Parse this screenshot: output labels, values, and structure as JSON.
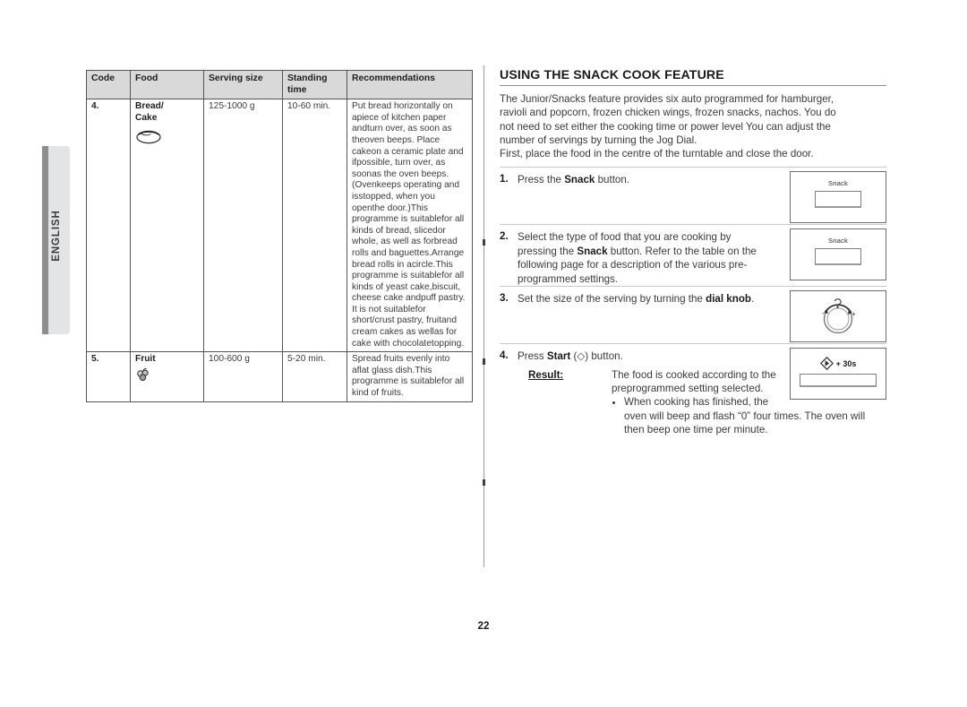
{
  "sidebar": {
    "language_tab": "ENGLISH"
  },
  "page_number": "22",
  "table": {
    "headers": {
      "code": "Code",
      "food": "Food",
      "serving_size": "Serving size",
      "standing_time_line1": "Standing",
      "standing_time_line2": "time",
      "recommendations": "Recommendations"
    },
    "rows": [
      {
        "code": "4.",
        "food": "Bread/",
        "food_line2": "Cake",
        "icon": "bread-loaf-icon",
        "serving_size": "125-1000 g",
        "standing_time": "10-60 min.",
        "recommendations": [
          "Put bread horizontally on a",
          "piece of kitchen paper and",
          "turn over, as soon as the",
          "oven beeps. Place cake",
          "on a ceramic plate and if",
          "possible, turn over, as soon",
          "as the oven beeps. (Oven",
          "keeps operating and is",
          "stopped, when you open",
          "the door.)",
          "This programme is suitable",
          "for all kinds of bread, sliced",
          "or whole, as well as for",
          "bread rolls and baguettes.",
          "Arrange bread rolls in a",
          "circle.",
          "This programme is suitable",
          "for all kinds of yeast cake,",
          "biscuit, cheese cake and",
          "puff pastry. It is not suitable",
          "for short/crust pastry, fruit",
          "and cream cakes as well",
          "as for cake with chocolate",
          "topping."
        ]
      },
      {
        "code": "5.",
        "food": "Fruit",
        "food_line2": "",
        "icon": "fruit-berries-icon",
        "serving_size": "100-600 g",
        "standing_time": "5-20 min.",
        "recommendations": [
          "Spread fruits evenly into a",
          "flat glass dish.",
          "This programme is suitable",
          "for all kind of fruits."
        ]
      }
    ]
  },
  "section": {
    "title": "USING THE SNACK COOK FEATURE",
    "intro": [
      "The Junior/Snacks feature provides six auto programmed for hamburger,",
      "ravioli and popcorn, frozen chicken wings, frozen snacks, nachos. You do",
      "not need to set either the cooking time or power level You can adjust the",
      "number of servings by turning the Jog Dial.",
      "First, place the food in the centre of the turntable and close the door."
    ],
    "steps": [
      {
        "number": "1.",
        "text_pre": "Press the ",
        "text_bold": "Snack",
        "text_post": " button.",
        "panel": {
          "type": "snack-button-panel",
          "label": "Snack"
        }
      },
      {
        "number": "2.",
        "lines": [
          "Select the type of food that you are cooking by",
          "pressing the Snack button. Refer to the table on the",
          "following page for a description of the various pre-",
          "programmed settings."
        ],
        "bold_word": "Snack",
        "panel": {
          "type": "snack-button-panel",
          "label": "Snack"
        }
      },
      {
        "number": "3.",
        "text_pre": "Set the size of the serving by turning the ",
        "text_bold": "dial knob",
        "text_post": ".",
        "panel": {
          "type": "dial-knob-panel",
          "label": ""
        }
      },
      {
        "number": "4.",
        "text_pre": "Press ",
        "text_bold": "Start",
        "text_post": " (◇) button.",
        "panel": {
          "type": "start-button-panel",
          "label": "+ 30s"
        },
        "result": {
          "label": "Result:",
          "lines": [
            "The food is cooked according to the",
            "preprogrammed setting selected."
          ],
          "bullets": [
            [
              "When cooking has finished, the",
              "oven will beep and flash “0” four times. The oven will",
              "then beep one time per minute."
            ]
          ]
        }
      }
    ]
  },
  "colors": {
    "table_header_bg": "#d9d9d9",
    "tab_bar": "#8e8e8e",
    "tab_face": "#e2e4e6",
    "text": "#3a3a3a",
    "heading": "#1a1a1a",
    "rule": "#8c8c8c"
  }
}
